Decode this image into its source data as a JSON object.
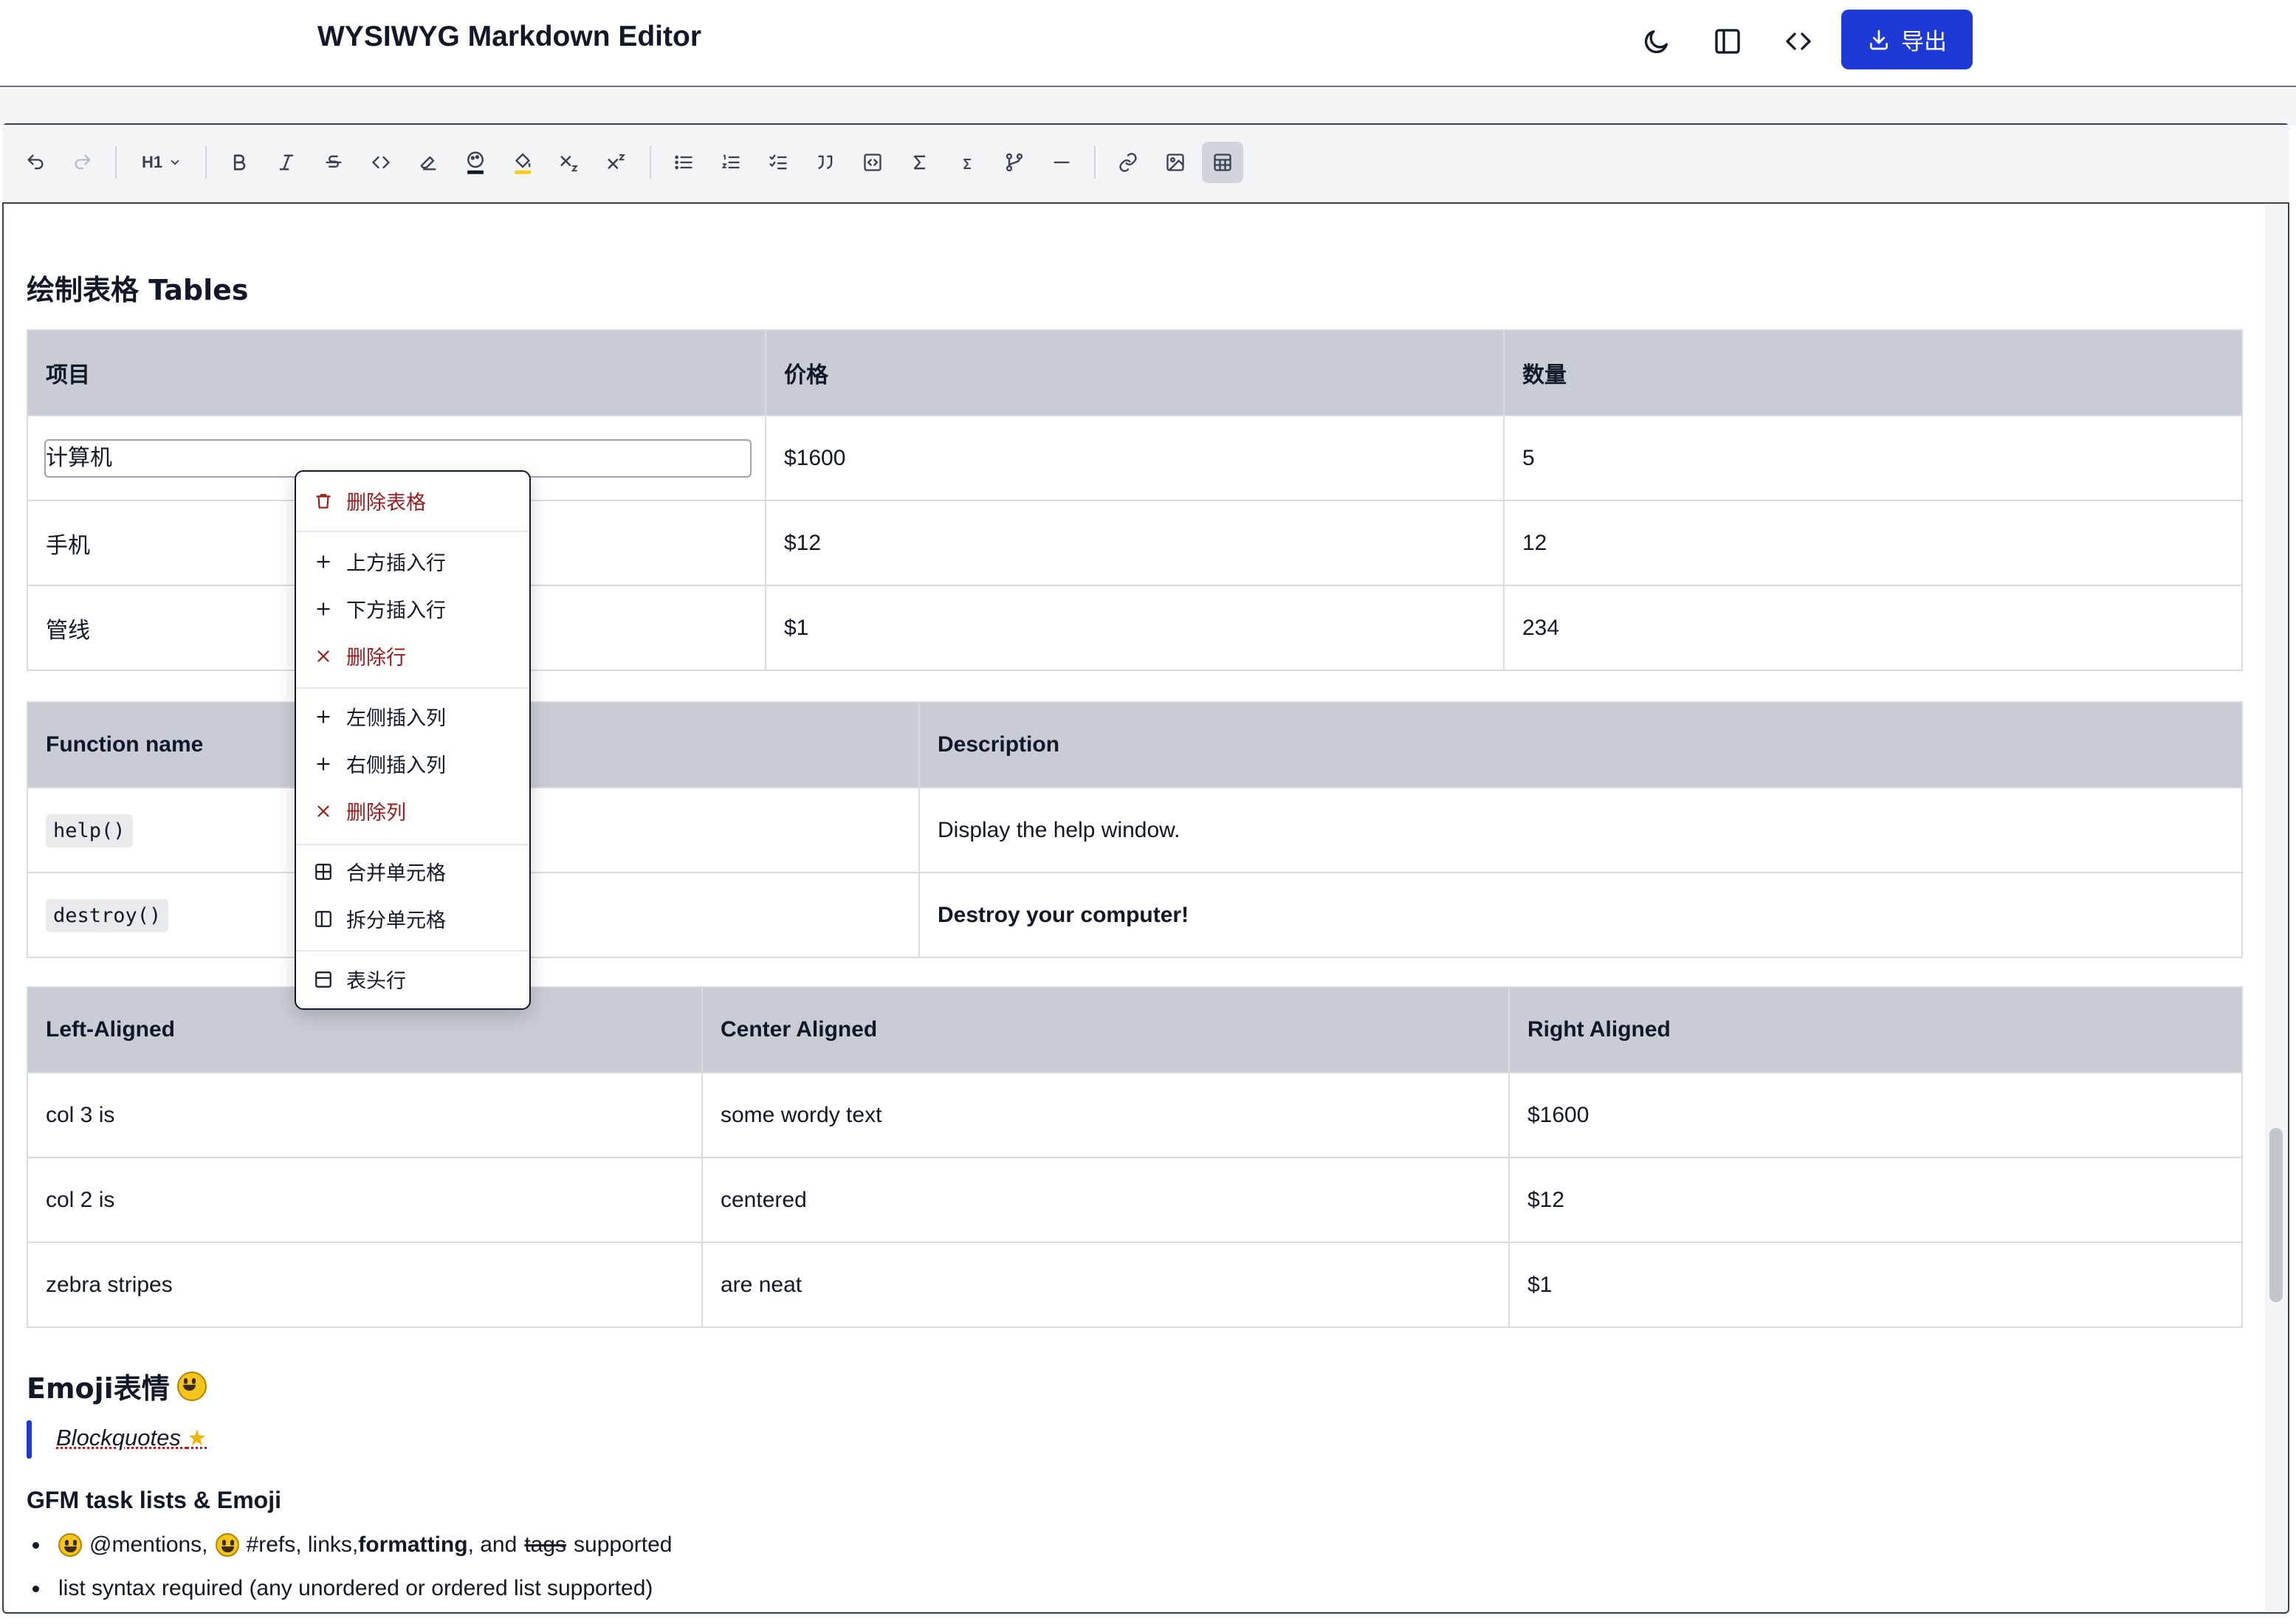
{
  "app": {
    "title": "WYSIWYG Markdown Editor",
    "export_label": "导出",
    "accent_color": "#1d3ad6",
    "top_icons": [
      "moon-icon",
      "sidebar-icon",
      "code-icon"
    ]
  },
  "toolbar": {
    "heading_label": "H1",
    "buttons": [
      "undo",
      "redo",
      "heading",
      "bold",
      "italic",
      "strikethrough",
      "inline-code",
      "clear-format",
      "text-color",
      "highlight",
      "subscript",
      "superscript",
      "bullet-list",
      "ordered-list",
      "task-list",
      "blockquote",
      "code-block",
      "math-block",
      "inline-math",
      "mermaid",
      "horizontal-rule",
      "link",
      "image",
      "table"
    ],
    "active_button": "table"
  },
  "content": {
    "section_title": "绘制表格 Tables",
    "table1": {
      "headers": [
        "项目",
        "价格",
        "数量"
      ],
      "rows": [
        [
          "计算机",
          "$1600",
          "5"
        ],
        [
          "手机",
          "$12",
          "12"
        ],
        [
          "管线",
          "$1",
          "234"
        ]
      ]
    },
    "table2": {
      "headers": [
        "Function name",
        "Description"
      ],
      "rows": [
        [
          "help()",
          "Display the help window."
        ],
        [
          "destroy()",
          "Destroy your computer!"
        ]
      ]
    },
    "table3": {
      "headers": [
        "Left-Aligned",
        "Center Aligned",
        "Right Aligned"
      ],
      "rows": [
        [
          "col 3 is",
          "some wordy text",
          "$1600"
        ],
        [
          "col 2 is",
          "centered",
          "$12"
        ],
        [
          "zebra stripes",
          "are neat",
          "$1"
        ]
      ]
    },
    "emoji_heading": "Emoji表情",
    "blockquote": "Blockquotes",
    "gfm_heading": "GFM task lists & Emoji",
    "list": {
      "item1": {
        "mentions": "@mentions,",
        "refs": "#refs, links,",
        "formatting": "formatting",
        "and": ", and",
        "tags": "tags",
        "supported": "supported"
      },
      "item2": "list syntax required (any unordered or ordered list supported)"
    }
  },
  "context_menu": {
    "delete_table": "删除表格",
    "insert_row_above": "上方插入行",
    "insert_row_below": "下方插入行",
    "delete_row": "删除行",
    "insert_col_left": "左侧插入列",
    "insert_col_right": "右侧插入列",
    "delete_col": "删除列",
    "merge_cells": "合并单元格",
    "split_cells": "拆分单元格",
    "header_row": "表头行"
  }
}
